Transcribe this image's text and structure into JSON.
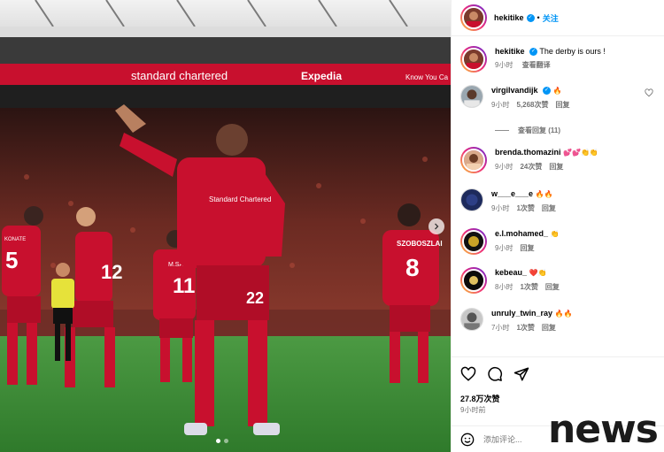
{
  "photo": {
    "stadium_banner": "standard chartered",
    "banner_sponsor_2": "Expedia",
    "banner_sponsor_3": "Know You Ca",
    "player_shirt_sponsor": "Standard Chartered",
    "center_number": "22",
    "left_number": "5",
    "left_back_number": "12",
    "mid_name": "M.SALAH",
    "mid_number": "11",
    "right_name": "SZOBOSZLAI",
    "right_number": "8",
    "left_name": "KONATE",
    "carousel_total": 2,
    "carousel_active": 1
  },
  "header": {
    "username": "hekitike",
    "verified_mark": "✓",
    "separator": "•",
    "follow_label": "关注"
  },
  "caption": {
    "username": "hekitike",
    "text": "The derby is ours !",
    "time": "9小时",
    "translate": "查看翻译"
  },
  "comments": [
    {
      "username": "virgilvandijk",
      "verified": true,
      "text": "🔥",
      "time": "9小时",
      "likes": "5,268次赞",
      "reply": "回复"
    },
    {
      "username": "brenda.thomazini",
      "verified": false,
      "text": "💕💕👏👏",
      "time": "9小时",
      "likes": "24次赞",
      "reply": "回复"
    },
    {
      "username": "w___e___e",
      "verified": false,
      "text": "🔥🔥",
      "time": "9小时",
      "likes": "1次赞",
      "reply": "回复"
    },
    {
      "username": "e.l.mohamed_",
      "verified": false,
      "text": "👏",
      "time": "9小时",
      "likes": "",
      "reply": "回复"
    },
    {
      "username": "kebeau_",
      "verified": false,
      "text": "❤️👏",
      "time": "8小时",
      "likes": "1次赞",
      "reply": "回复"
    },
    {
      "username": "unruly_twin_ray",
      "verified": false,
      "text": "🔥🔥",
      "time": "7小时",
      "likes": "1次赞",
      "reply": "回复"
    }
  ],
  "view_replies": "查看回复 (11)",
  "footer": {
    "likes": "27.8万次赞",
    "time": "9小时前",
    "comment_placeholder": "添加评论..."
  },
  "watermark": "news",
  "colors": {
    "accent": "#0095f6",
    "kit_red": "#c8102e",
    "pitch_green": "#3f8a3a"
  }
}
